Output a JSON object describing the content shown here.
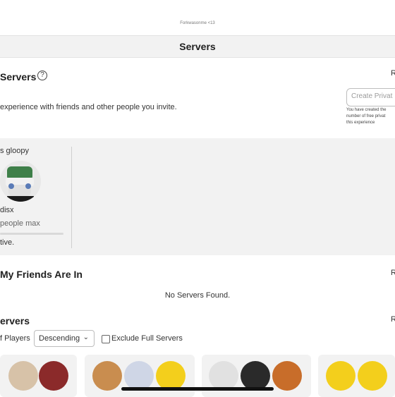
{
  "top": {
    "caption": "Forkwasonme <13"
  },
  "tab": {
    "title": "Servers"
  },
  "private_servers": {
    "title": "Servers",
    "desc": "experience with friends and other people you invite.",
    "right_button_fragment": "R",
    "input_placeholder": "Create Privat",
    "note_lines": [
      "You have created the",
      "number of free privat",
      "this experience"
    ]
  },
  "server_card": {
    "name": "s gloopy",
    "owner": "disx",
    "capacity": "people max",
    "status": "tive."
  },
  "friends_section": {
    "title": "My Friends Are In",
    "right_fragment": "R",
    "empty_text": "No Servers Found."
  },
  "servers_section": {
    "title": "ervers",
    "right_fragment": "R",
    "sort_label": "f Players",
    "sort_value": "Descending",
    "exclude_label": "Exclude Full Servers"
  },
  "colors": {
    "panel": "#f2f2f2",
    "accent_green": "#2f7a46",
    "avatar_yellow": "#f3cf1c"
  }
}
